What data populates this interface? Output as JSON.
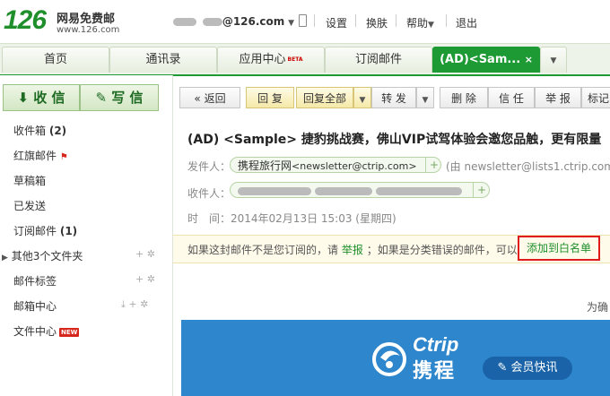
{
  "header": {
    "logo_number": "126",
    "logo_name": "网易免费邮",
    "logo_url": "www.126.com",
    "account_domain": "@126.com",
    "nav": [
      "设置",
      "换肤",
      "帮助",
      "退出"
    ]
  },
  "tabs": [
    {
      "label": "首页",
      "badge": ""
    },
    {
      "label": "通讯录",
      "badge": ""
    },
    {
      "label": "应用中心",
      "badge": "BETA"
    },
    {
      "label": "订阅邮件",
      "badge": ""
    },
    {
      "label": "(AD)<Sam...",
      "badge": ""
    }
  ],
  "sidebar": {
    "receive_label": "收 信",
    "compose_label": "写 信",
    "items": [
      {
        "label": "收件箱",
        "count": "(2)"
      },
      {
        "label": "红旗邮件",
        "count": ""
      },
      {
        "label": "草稿箱",
        "count": ""
      },
      {
        "label": "已发送",
        "count": ""
      },
      {
        "label": "订阅邮件",
        "count": "(1)"
      },
      {
        "label": "其他3个文件夹",
        "count": ""
      },
      {
        "label": "邮件标签",
        "count": ""
      },
      {
        "label": "邮箱中心",
        "count": ""
      },
      {
        "label": "文件中心",
        "count": "",
        "badge": "NEW"
      }
    ]
  },
  "toolbar": {
    "back": "返回",
    "reply": "回 复",
    "reply_all": "回复全部",
    "forward": "转 发",
    "delete": "删 除",
    "trust": "信 任",
    "report": "举 报",
    "tag": "标记"
  },
  "mail": {
    "subject": "(AD) <Sample> 捷豹挑战赛，佛山VIP试驾体验会邀您品触，更有限量",
    "sender_label": "发件人：",
    "sender_name": "携程旅行网",
    "sender_email": "<newsletter@ctrip.com>",
    "sender_via": "(由 newsletter@lists1.ctrip.com",
    "recipient_label": "收件人：",
    "time_label": "时　间：",
    "time_value": "2014年02月13日 15:03 (星期四)",
    "notice_prefix": "如果这封邮件不是您订阅的，请",
    "notice_report": "举报",
    "notice_middle": "；如果是分类错误的邮件，可以",
    "whitelist_label": "添加到白名单",
    "body_hint": "为确"
  },
  "banner": {
    "brand_latin": "Ctrip",
    "brand_cn": "携程",
    "badge": "会员快讯",
    "bg_color": "#2e86cd"
  },
  "colors": {
    "accent": "#1e9a35",
    "highlight_border": "#e01b1b"
  }
}
